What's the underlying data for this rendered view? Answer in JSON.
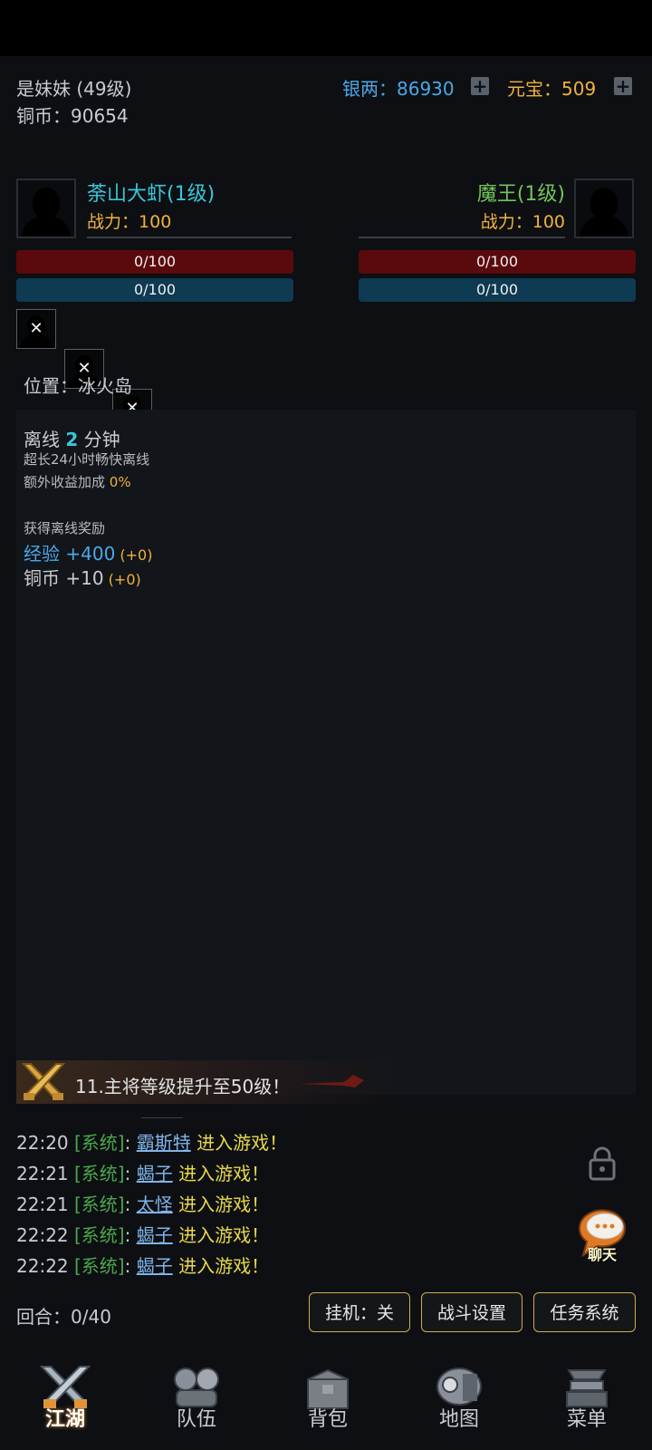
{
  "player": {
    "name_level": "是妹妹 (49级)",
    "copper_label": "铜币：",
    "copper_value": "90654"
  },
  "currency": {
    "silver_label": "银两：",
    "silver_value": "86930",
    "yuanbao_label": "元宝：",
    "yuanbao_value": "509"
  },
  "left_fighter": {
    "name": "荼山大虾(1级)",
    "power_label": "战力：",
    "power_value": "100",
    "hp": "0/100",
    "mp": "0/100"
  },
  "right_fighter": {
    "name": "魔王(1级)",
    "power_label": "战力：",
    "power_value": "100",
    "hp": "0/100",
    "mp": "0/100"
  },
  "location": {
    "label": "位置：",
    "value": "冰火岛"
  },
  "offline": {
    "prefix": "离线 ",
    "minutes": "2",
    "suffix": " 分钟",
    "line1": "超长24小时畅快离线",
    "bonus_label": "额外收益加成 ",
    "bonus_value": "0%",
    "reward_title": "获得离线奖励",
    "exp_label": "经验 ",
    "exp_value": "+400",
    "exp_extra": " (+0)",
    "copper_label": "铜币 ",
    "copper_value": "+10",
    "copper_extra": " (+0)"
  },
  "quest": {
    "text": "11.主将等级提升至50级！"
  },
  "chat": [
    {
      "time": "22:20",
      "tag": "[系统]",
      "sep": ":",
      "name": "霸斯特",
      "msg": " 进入游戏！"
    },
    {
      "time": "22:21",
      "tag": "[系统]",
      "sep": ":",
      "name": "蝎子",
      "msg": " 进入游戏！"
    },
    {
      "time": "22:21",
      "tag": "[系统]",
      "sep": ":",
      "name": "太怪",
      "msg": " 进入游戏！"
    },
    {
      "time": "22:22",
      "tag": "[系统]",
      "sep": ":",
      "name": "蝎子",
      "msg": " 进入游戏！"
    },
    {
      "time": "22:22",
      "tag": "[系统]",
      "sep": ":",
      "name": "蝎子",
      "msg": " 进入游戏！"
    }
  ],
  "chat_button": {
    "label": "聊天"
  },
  "round": {
    "label": "回合：",
    "value": "0/40"
  },
  "buttons": {
    "auto": "挂机：关",
    "battle": "战斗设置",
    "task": "任务系统"
  },
  "nav": [
    "江湖",
    "队伍",
    "背包",
    "地图",
    "菜单"
  ],
  "colors": {
    "silver": "#4aa8e8",
    "gold": "#f0b23c",
    "hp": "#5a0a0c",
    "mp": "#0e3a52",
    "button_border": "#d4a94a"
  },
  "icons": [
    "plus-icon",
    "silhouette-icon",
    "close-icon",
    "crossed-swords-icon",
    "lock-icon",
    "chat-bubble-icon",
    "jianghu-nav-icon",
    "team-nav-icon",
    "bag-nav-icon",
    "map-nav-icon",
    "menu-nav-icon"
  ]
}
